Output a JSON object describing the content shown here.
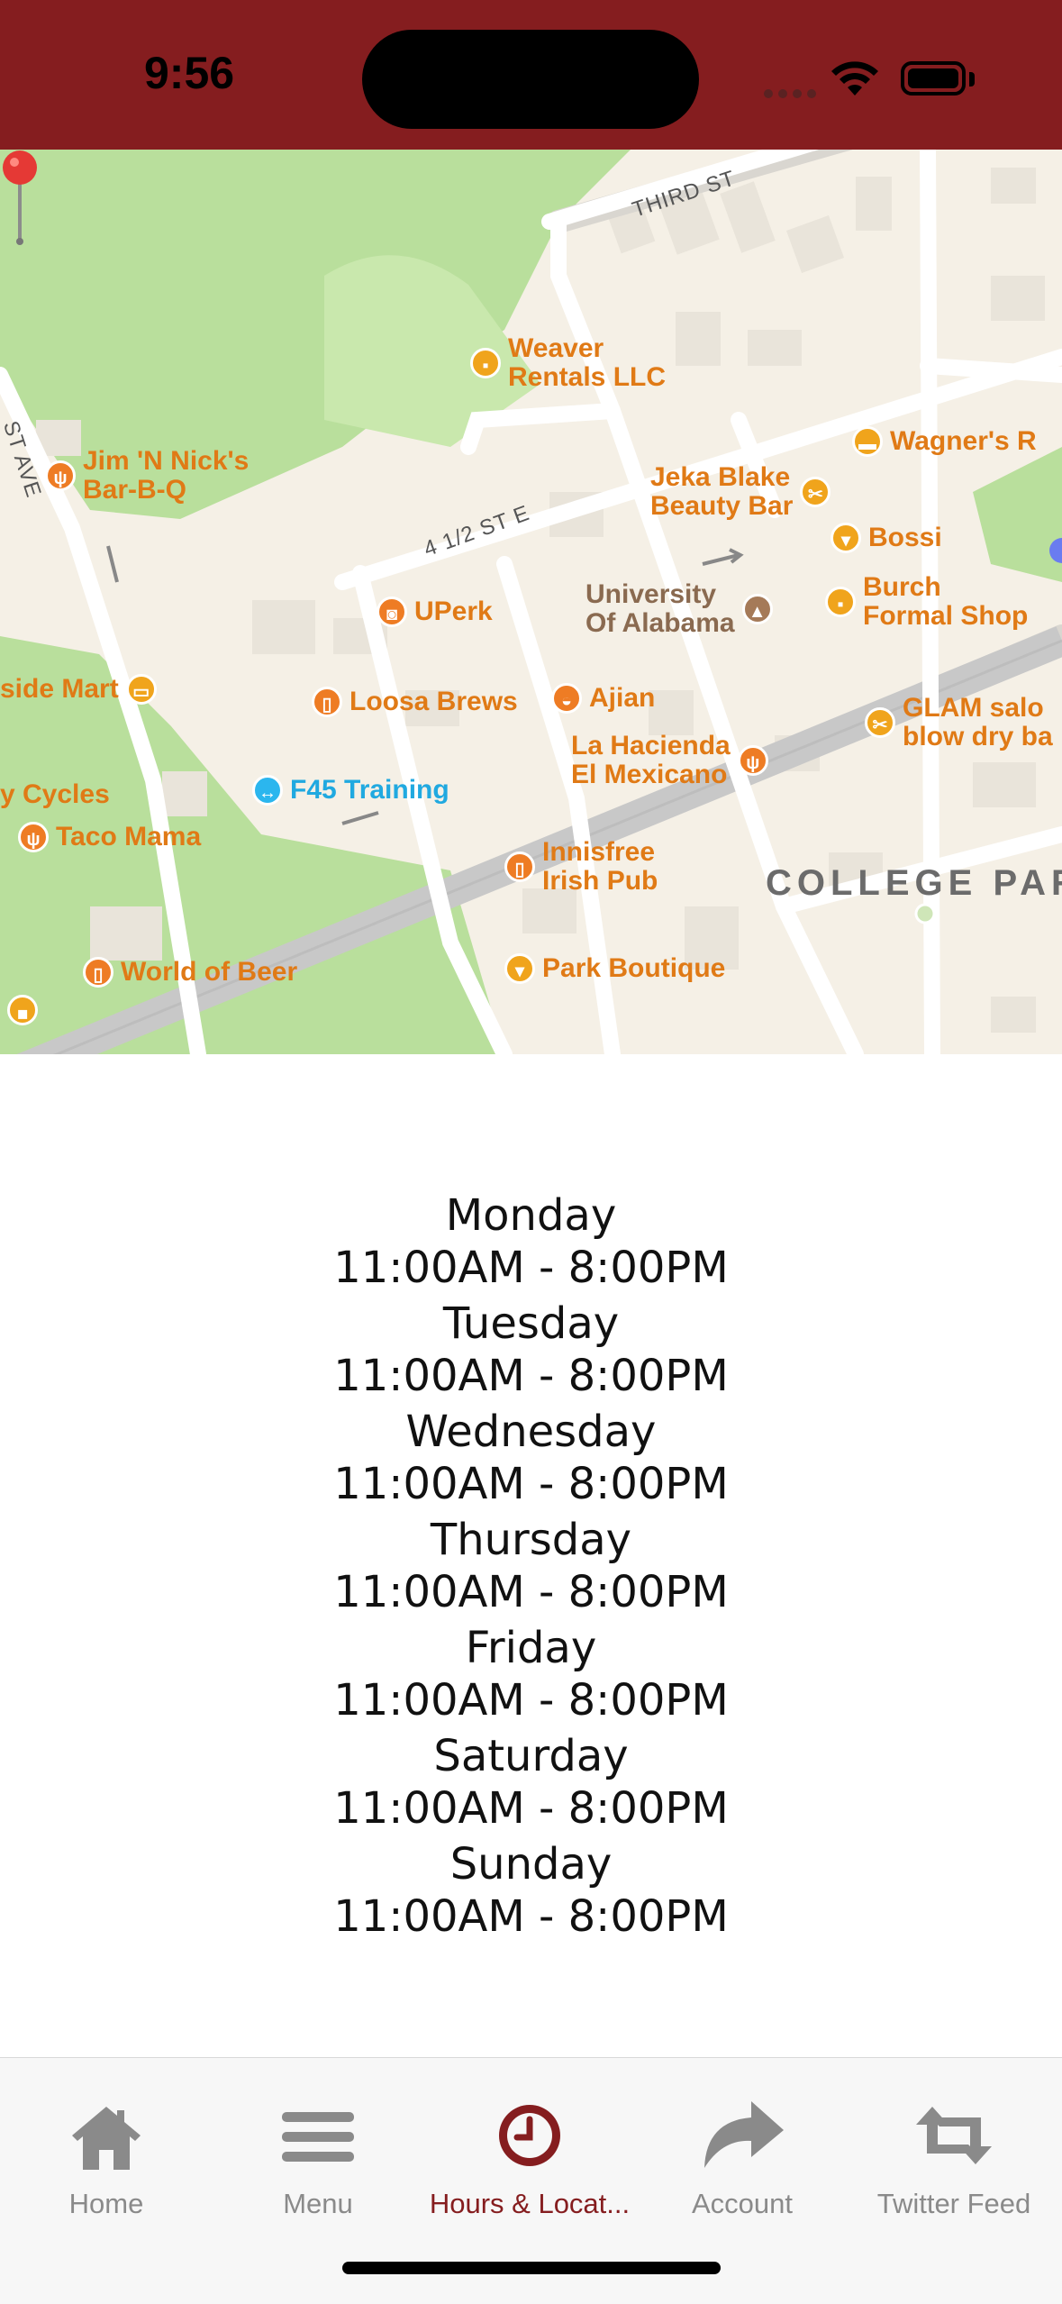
{
  "status_bar": {
    "time": "9:56",
    "background": "#851d1f"
  },
  "map": {
    "streets": [
      "THIRD ST",
      "4 1/2 ST E",
      "ST AVE"
    ],
    "district": "COLLEGE PAR",
    "pin_color": "#e53935",
    "places": [
      {
        "name": "Weaver Rentals LLC",
        "line1": "Weaver",
        "line2": "Rentals LLC",
        "icon": "briefcase-icon"
      },
      {
        "name": "Jim 'N Nick's Bar-B-Q",
        "line1": "Jim 'N Nick's",
        "line2": "Bar-B-Q",
        "icon": "fork-knife-icon"
      },
      {
        "name": "Wagner's R",
        "line1": "Wagner's R",
        "icon": "shoe-icon"
      },
      {
        "name": "Jeka Blake Beauty Bar",
        "line1": "Jeka Blake",
        "line2": "Beauty Bar",
        "icon": "scissors-icon"
      },
      {
        "name": "Bossi",
        "line1": "Bossi",
        "icon": "shirt-icon"
      },
      {
        "name": "UPerk",
        "line1": "UPerk",
        "icon": "coffee-icon"
      },
      {
        "name": "University Of Alabama",
        "line1": "University",
        "line2": "Of Alabama",
        "icon": "graduation-cap-icon"
      },
      {
        "name": "Burch Formal Shop",
        "line1": "Burch",
        "line2": "Formal Shop",
        "icon": "briefcase-icon"
      },
      {
        "name": "side Mart",
        "line1": "side Mart",
        "icon": "store-icon"
      },
      {
        "name": "Loosa Brews",
        "line1": "Loosa Brews",
        "icon": "beer-icon"
      },
      {
        "name": "Ajian",
        "line1": "Ajian",
        "icon": "bun-icon"
      },
      {
        "name": "GLAM salon blow dry ba",
        "line1": "GLAM salo",
        "line2": "blow dry ba",
        "icon": "scissors-icon"
      },
      {
        "name": "y Cycles",
        "line1": "y Cycles"
      },
      {
        "name": "F45 Training",
        "line1": "F45 Training",
        "icon": "dumbbell-icon"
      },
      {
        "name": "La Hacienda El Mexicano",
        "line1": "La Hacienda",
        "line2": "El Mexicano",
        "icon": "fork-knife-icon"
      },
      {
        "name": "Taco Mama",
        "line1": "Taco Mama",
        "icon": "fork-knife-icon"
      },
      {
        "name": "Innisfree Irish Pub",
        "line1": "Innisfree",
        "line2": "Irish Pub",
        "icon": "beer-icon"
      },
      {
        "name": "World of Beer",
        "line1": "World of Beer",
        "icon": "beer-icon"
      },
      {
        "name": "Park Boutique",
        "line1": "Park Boutique",
        "icon": "shirt-icon"
      }
    ]
  },
  "hours": [
    {
      "day": "Monday",
      "time": "11:00AM - 8:00PM"
    },
    {
      "day": "Tuesday",
      "time": "11:00AM - 8:00PM"
    },
    {
      "day": "Wednesday",
      "time": "11:00AM - 8:00PM"
    },
    {
      "day": "Thursday",
      "time": "11:00AM - 8:00PM"
    },
    {
      "day": "Friday",
      "time": "11:00AM - 8:00PM"
    },
    {
      "day": "Saturday",
      "time": "11:00AM - 8:00PM"
    },
    {
      "day": "Sunday",
      "time": "11:00AM - 8:00PM"
    }
  ],
  "tab_bar": {
    "active_color": "#851d1f",
    "inactive_color": "#8a8a8a",
    "tabs": [
      {
        "label": "Home",
        "icon": "home-icon"
      },
      {
        "label": "Menu",
        "icon": "menu-icon"
      },
      {
        "label": "Hours & Locat...",
        "icon": "clock-icon",
        "active": true
      },
      {
        "label": "Account",
        "icon": "share-arrow-icon"
      },
      {
        "label": "Twitter Feed",
        "icon": "retweet-icon"
      }
    ]
  }
}
